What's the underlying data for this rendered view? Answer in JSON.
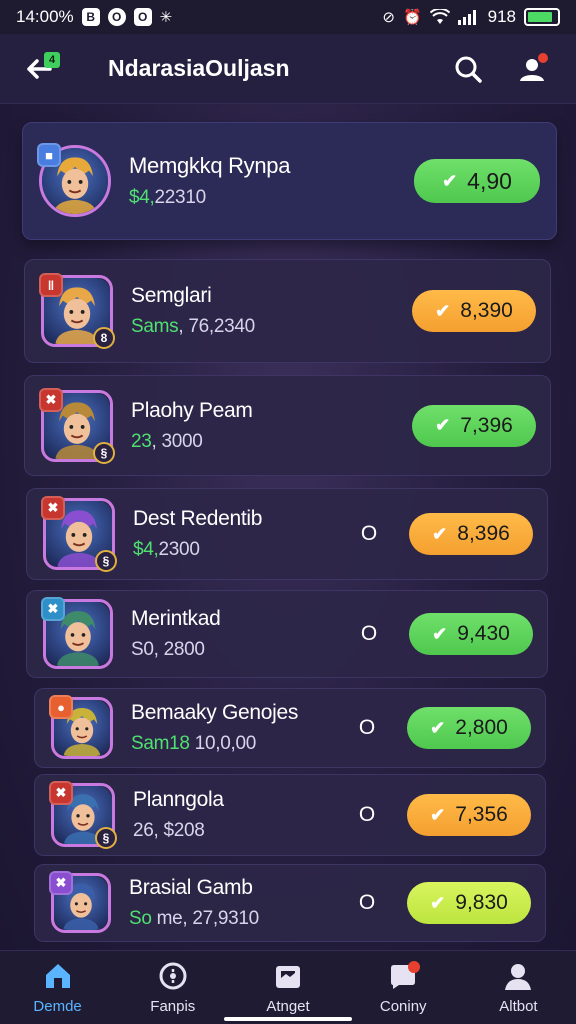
{
  "status_bar": {
    "time": "14:00%",
    "left_icons": [
      "B",
      "O",
      "O"
    ],
    "extra": "✳",
    "right_text": "918",
    "battery_level": 0.85
  },
  "header": {
    "back_badge": "4",
    "title": "NdarasiaOuljasn"
  },
  "rows": [
    {
      "name": "Memgkkq Rynpa",
      "sub_prefix": "$4,",
      "sub_rest": "22310",
      "value": "4,90",
      "pill_color": "green",
      "radio": "",
      "corner_icon": "■",
      "corner_color": "#4a7de0",
      "level": "",
      "avatar_hue": "#e6a93a"
    },
    {
      "name": "Semglari",
      "sub_prefix": "Sams",
      "sub_rest": ", 76,2340",
      "value": "8,390",
      "pill_color": "orange",
      "radio": "",
      "corner_icon": "‖",
      "corner_color": "#c8372f",
      "level": "8",
      "avatar_hue": "#e8a848"
    },
    {
      "name": "Plaohy Peam",
      "sub_prefix": "23",
      "sub_rest": ", 3000",
      "value": "7,396",
      "pill_color": "green",
      "radio": "",
      "corner_icon": "✖",
      "corner_color": "#c8372f",
      "level": "§",
      "avatar_hue": "#b9893a"
    },
    {
      "name": "Dest Redentib",
      "sub_prefix": "$4,",
      "sub_rest": "2300",
      "value": "8,396",
      "pill_color": "orange",
      "radio": "O",
      "corner_icon": "✖",
      "corner_color": "#c8372f",
      "level": "§",
      "avatar_hue": "#8a4ed0"
    },
    {
      "name": "Merintkad",
      "sub_prefix": "",
      "sub_rest": "S0, 2800",
      "value": "9,430",
      "pill_color": "green",
      "radio": "O",
      "corner_icon": "✖",
      "corner_color": "#2f8fc8",
      "level": "",
      "avatar_hue": "#3e8a6a"
    },
    {
      "name": "Bemaaky Genojes",
      "sub_prefix": "Sam18",
      "sub_rest": " 10,0,00",
      "value": "2,800",
      "pill_color": "green",
      "radio": "O",
      "corner_icon": "●",
      "corner_color": "#e8602f",
      "level": "",
      "avatar_hue": "#c9b23a"
    },
    {
      "name": "Planngola",
      "sub_prefix": "",
      "sub_rest": "26, $208",
      "value": "7,356",
      "pill_color": "orange",
      "radio": "O",
      "corner_icon": "✖",
      "corner_color": "#c8372f",
      "level": "§",
      "avatar_hue": "#3a6fb0"
    },
    {
      "name": "Brasial Gamb",
      "sub_prefix": "So",
      "sub_rest": " me, 27,9310",
      "value": "9,830",
      "pill_color": "lime",
      "radio": "O",
      "corner_icon": "✖",
      "corner_color": "#8a4ed0",
      "level": "",
      "avatar_hue": "#3a5fa8"
    }
  ],
  "nav": [
    {
      "label": "Demde",
      "icon": "home-icon",
      "active": true
    },
    {
      "label": "Fanpis",
      "icon": "compass-icon",
      "active": false
    },
    {
      "label": "Atnget",
      "icon": "inbox-icon",
      "active": false
    },
    {
      "label": "Coniny",
      "icon": "chat-icon",
      "active": false
    },
    {
      "label": "Altbot",
      "icon": "profile-icon",
      "active": false
    }
  ]
}
